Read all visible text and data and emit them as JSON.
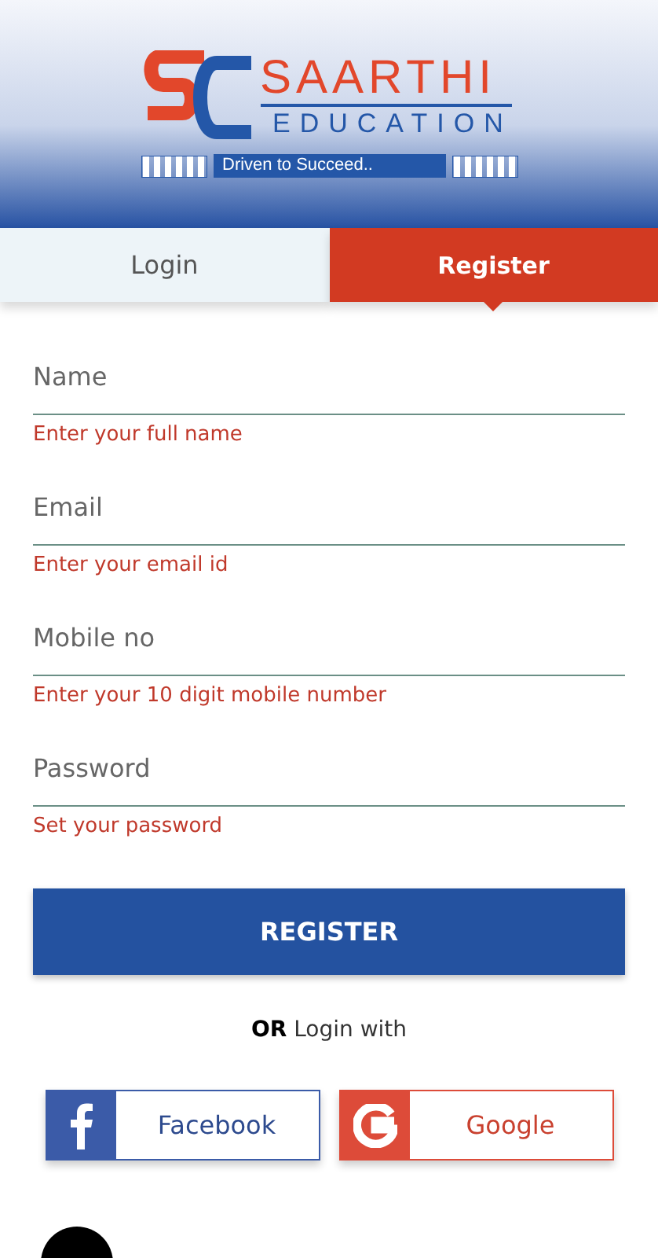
{
  "logo": {
    "name": "SAARTHI",
    "subtitle": "EDUCATION",
    "tagline": "Driven to Succeed.."
  },
  "tabs": [
    {
      "label": "Login",
      "selected": false
    },
    {
      "label": "Register",
      "selected": true
    }
  ],
  "fields": [
    {
      "placeholder": "Name",
      "hint": "Enter your full name"
    },
    {
      "placeholder": "Email",
      "hint": "Enter your email id"
    },
    {
      "placeholder": "Mobile no",
      "hint": "Enter your 10 digit mobile number"
    },
    {
      "placeholder": "Password",
      "hint": "Set your password"
    }
  ],
  "submit": "REGISTER",
  "alt_login": {
    "bold": "OR",
    "text": "Login with"
  },
  "social": [
    {
      "kind": "facebook",
      "label": "Facebook"
    },
    {
      "kind": "google",
      "label": "Google"
    }
  ]
}
